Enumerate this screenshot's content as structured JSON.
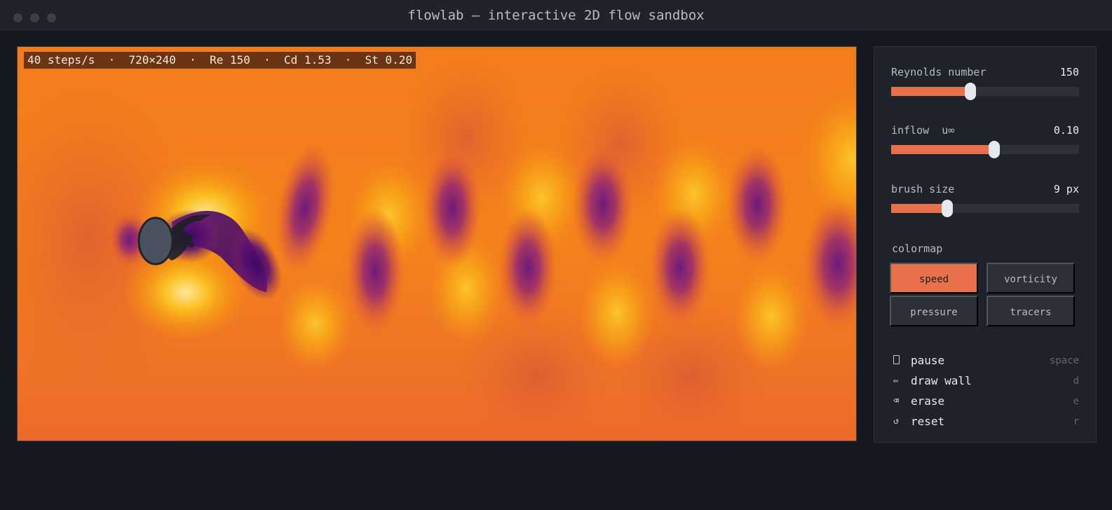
{
  "window": {
    "title": "flowlab — interactive 2D flow sandbox"
  },
  "hud": {
    "text": "40 steps/s  ·  720×240  ·  Re 150  ·  Cd 1.53  ·  St 0.20"
  },
  "controls": [
    {
      "label": "Reynolds number",
      "value_text": "150",
      "fraction": 0.42
    },
    {
      "label": "inflow  u∞",
      "value_text": "0.10",
      "fraction": 0.55
    },
    {
      "label": "brush size",
      "value_text": "9 px",
      "fraction": 0.3
    }
  ],
  "colormap": {
    "label": "colormap",
    "options": [
      "speed",
      "vorticity",
      "pressure",
      "tracers"
    ],
    "selected": "speed"
  },
  "actions": [
    {
      "icon": "pause-icon",
      "label": "pause",
      "key": "space"
    },
    {
      "icon": "pencil-icon",
      "label": "draw wall",
      "key": "d"
    },
    {
      "icon": "eraser-icon",
      "label": "erase",
      "key": "e"
    },
    {
      "icon": "reset-icon",
      "label": "reset",
      "key": "r"
    }
  ],
  "colors": {
    "accent": "#e8704b",
    "background": "#15181e",
    "panel": "#1e222a"
  }
}
